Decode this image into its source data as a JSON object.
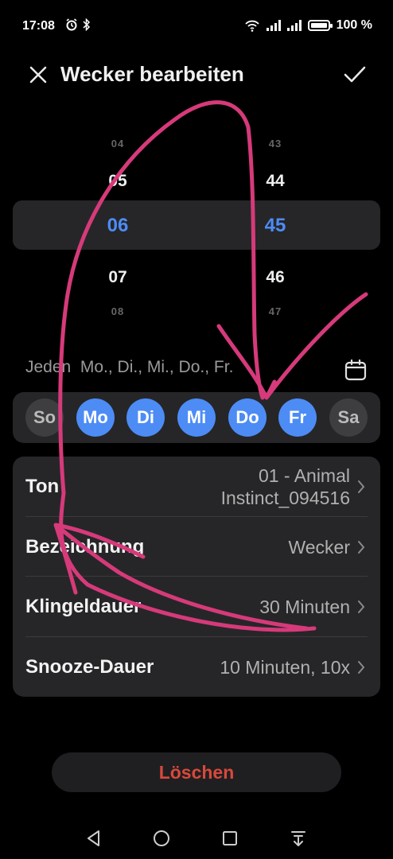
{
  "status_bar": {
    "time": "17:08",
    "battery": "100 %",
    "battery_level": 1.0
  },
  "header": {
    "title": "Wecker bearbeiten"
  },
  "time_picker": {
    "hours": [
      "04",
      "05",
      "06",
      "07",
      "08"
    ],
    "minutes": [
      "43",
      "44",
      "45",
      "46",
      "47"
    ],
    "selected_hour": "06",
    "selected_minute": "45"
  },
  "repeat": {
    "text": "Jeden  Mo., Di., Mi., Do., Fr."
  },
  "days": [
    {
      "label": "So",
      "active": false
    },
    {
      "label": "Mo",
      "active": true
    },
    {
      "label": "Di",
      "active": true
    },
    {
      "label": "Mi",
      "active": true
    },
    {
      "label": "Do",
      "active": true
    },
    {
      "label": "Fr",
      "active": true
    },
    {
      "label": "Sa",
      "active": false
    }
  ],
  "settings": [
    {
      "label": "Ton",
      "value_line1": "01 - Animal",
      "value_line2": "Instinct_094516"
    },
    {
      "label": "Bezeichnung",
      "value": "Wecker"
    },
    {
      "label": "Klingeldauer",
      "value": "30 Minuten"
    },
    {
      "label": "Snooze-Dauer",
      "value": "10 Minuten, 10x"
    }
  ],
  "delete_button": {
    "label": "Löschen"
  },
  "colors": {
    "accent": "#4d8cf5",
    "danger": "#d9483b",
    "scribble": "#d63a7a",
    "card": "#262628"
  }
}
